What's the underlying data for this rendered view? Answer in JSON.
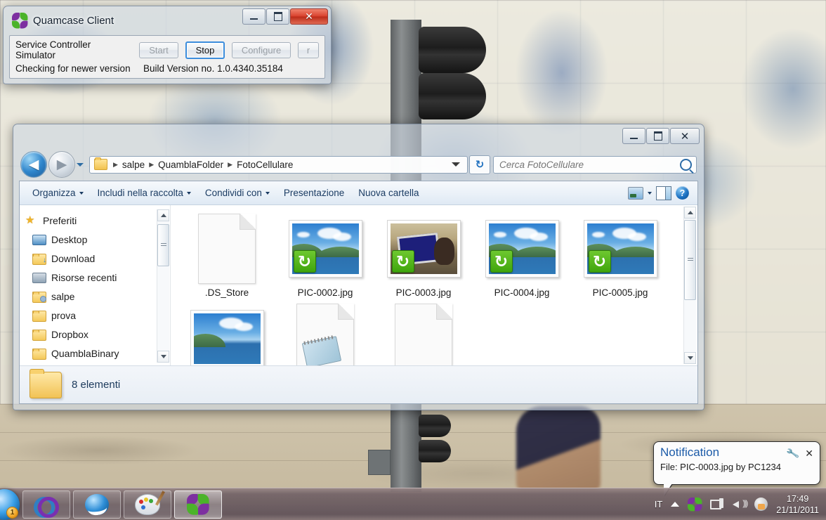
{
  "desktop": {
    "wallpaper_description": "Portuguese azulejo blue-and-white tile mural with traffic light and stone wall"
  },
  "quamcase_window": {
    "title": "Quamcase Client",
    "app_icon": "flower-icon",
    "titlebar_buttons": {
      "minimize": "minimize-icon",
      "maximize": "maximize-icon",
      "close": "✕"
    },
    "label_service": "Service Controller Simulator",
    "label_checking": "Checking for newer version",
    "buttons": {
      "start": "Start",
      "stop": "Stop",
      "configure": "Configure",
      "extra": "r"
    },
    "build_version": "Build Version no. 1.0.4340.35184"
  },
  "explorer": {
    "titlebar_buttons": {
      "minimize": "minimize-icon",
      "maximize": "maximize-icon",
      "close": "✕"
    },
    "nav": {
      "back": "◀",
      "forward": "▶",
      "recent_caret": "▼",
      "refresh": "↻"
    },
    "breadcrumbs": [
      "salpe",
      "QuamblaFolder",
      "FotoCellulare"
    ],
    "crumb_separator": "▶",
    "search": {
      "placeholder": "Cerca FotoCellulare",
      "value": "",
      "icon": "search-icon"
    },
    "toolbar": {
      "items": [
        {
          "label": "Organizza",
          "has_caret": true
        },
        {
          "label": "Includi nella raccolta",
          "has_caret": true
        },
        {
          "label": "Condividi con",
          "has_caret": true
        },
        {
          "label": "Presentazione",
          "has_caret": false
        },
        {
          "label": "Nuova cartella",
          "has_caret": false
        }
      ],
      "view_icon": "view-options-icon",
      "view_caret": "▼",
      "preview_pane_icon": "preview-pane-icon",
      "help_icon": "?"
    },
    "sidebar": {
      "items": [
        {
          "label": "Preferiti",
          "icon": "star-icon",
          "type": "head"
        },
        {
          "label": "Desktop",
          "icon": "monitor-icon",
          "type": "item"
        },
        {
          "label": "Download",
          "icon": "folder-download-icon",
          "type": "item"
        },
        {
          "label": "Risorse recenti",
          "icon": "network-recent-icon",
          "type": "item"
        },
        {
          "label": "salpe",
          "icon": "folder-user-icon",
          "type": "item"
        },
        {
          "label": "prova",
          "icon": "folder-icon",
          "type": "item"
        },
        {
          "label": "Dropbox",
          "icon": "folder-icon",
          "type": "item"
        },
        {
          "label": "QuamblaBinary",
          "icon": "folder-icon",
          "type": "item"
        }
      ]
    },
    "files": [
      {
        "name": ".DS_Store",
        "kind": "document",
        "badge": false
      },
      {
        "name": "PIC-0002.jpg",
        "kind": "photo-landscape",
        "badge": true
      },
      {
        "name": "PIC-0003.jpg",
        "kind": "photo-selfie",
        "badge": true
      },
      {
        "name": "PIC-0004.jpg",
        "kind": "photo-landscape",
        "badge": true
      },
      {
        "name": "PIC-0005.jpg",
        "kind": "photo-landscape",
        "badge": true
      },
      {
        "name": "",
        "kind": "photo-landscape",
        "badge": false
      },
      {
        "name": "",
        "kind": "notepad",
        "badge": false
      },
      {
        "name": "",
        "kind": "document",
        "badge": false
      }
    ],
    "status": {
      "icon": "folder-icon",
      "text": "8 elementi"
    }
  },
  "notification": {
    "title": "Notification",
    "body": "File: PIC-0003.jpg by PC1234",
    "options_icon": "wrench-icon",
    "close_icon": "✕"
  },
  "taskbar": {
    "start_icon": "start-orb-icon",
    "start_badge": "1",
    "buttons": [
      {
        "name": "infinity-app",
        "icon": "infinity-icon",
        "active": false
      },
      {
        "name": "internet-explorer",
        "icon": "ie-icon",
        "active": false
      },
      {
        "name": "paint",
        "icon": "paint-palette-icon",
        "active": false
      },
      {
        "name": "quamcase-client",
        "icon": "flower-icon",
        "active": true
      }
    ],
    "tray": {
      "language": "IT",
      "show_hidden_icon": "▲",
      "icons": [
        "flower-icon",
        "network-icon",
        "volume-icon",
        "action-center-icon"
      ],
      "time": "17:49",
      "date": "21/11/2011"
    }
  }
}
